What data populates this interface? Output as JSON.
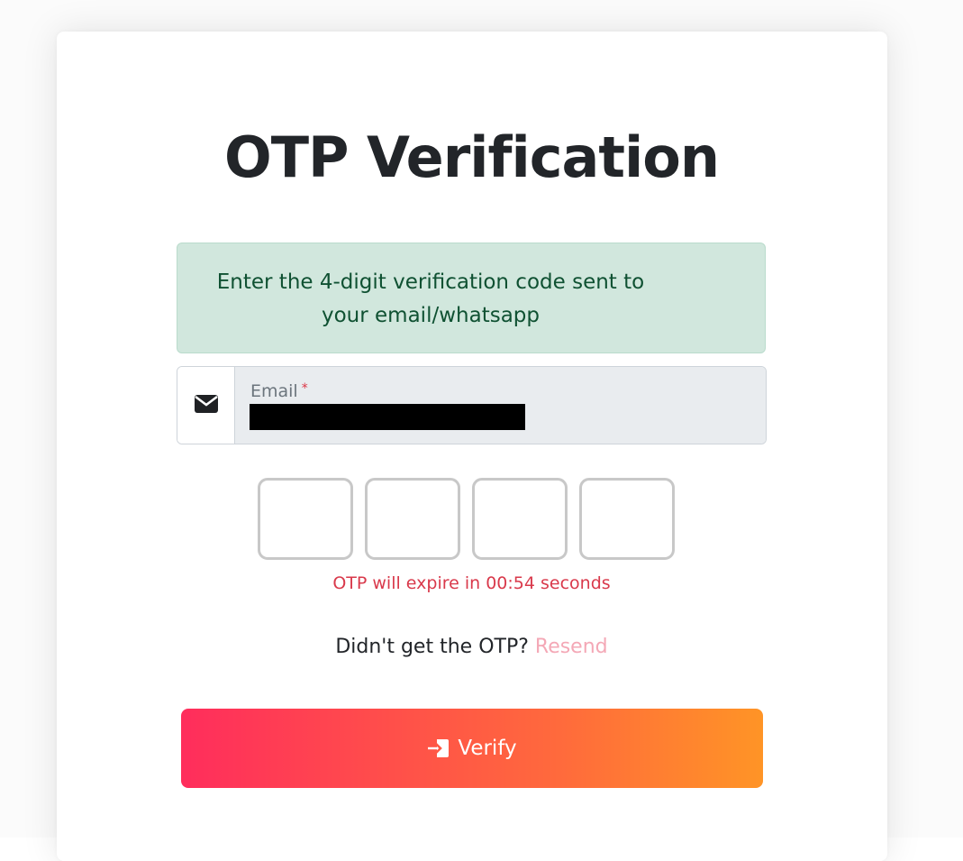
{
  "page": {
    "title": "OTP Verification"
  },
  "info": {
    "message_line1": "Enter the 4-digit verification code sent to",
    "message_line2": "your email/whatsapp"
  },
  "email": {
    "icon": "envelope-icon",
    "label": "Email",
    "required_mark": "*",
    "value_redacted": true
  },
  "otp": {
    "digits": [
      "",
      "",
      "",
      ""
    ],
    "timer_text": "OTP will expire in 00:54 seconds"
  },
  "resend": {
    "prompt": "Didn't get the OTP?",
    "link_label": "Resend"
  },
  "verify_button": {
    "icon": "sign-in-icon",
    "label": "Verify"
  },
  "colors": {
    "title": "#222529",
    "info_bg": "#d1e7dd",
    "info_text": "#0f5132",
    "timer": "#d9394b",
    "resend_link": "#f4a8b6",
    "button_gradient_start": "#ff2d5c",
    "button_gradient_end": "#ff9426"
  }
}
